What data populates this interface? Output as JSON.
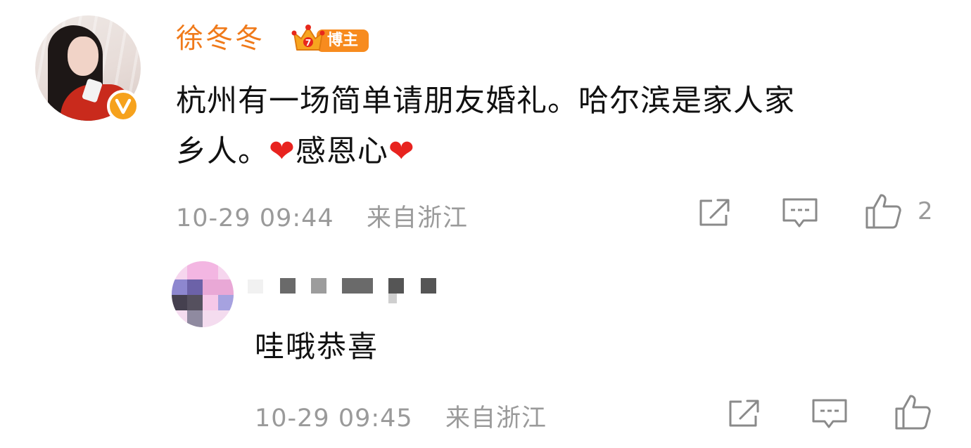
{
  "main_comment": {
    "username": "徐冬冬",
    "badge_label": "博主",
    "text_line1": "杭州有一场简单请朋友婚礼。哈尔滨是家人家",
    "text_line2_part1": "乡人。",
    "heart": "❤",
    "text_line2_part2": "感恩心",
    "timestamp": "10-29 09:44",
    "location": "来自浙江",
    "like_count": "2",
    "verified_icon": "verified-v-icon"
  },
  "reply": {
    "username_obscured": true,
    "text": "哇哦恭喜",
    "timestamp": "10-29 09:45",
    "location": "来自浙江"
  },
  "colors": {
    "username": "#f07a1a",
    "badge": "#f78b1e",
    "meta": "#9a9a9a",
    "heart": "#e8231f",
    "icon_stroke": "#8a8a8a"
  },
  "icons": [
    "share-icon",
    "comment-icon",
    "like-icon",
    "verified-v-icon",
    "crown-icon"
  ]
}
